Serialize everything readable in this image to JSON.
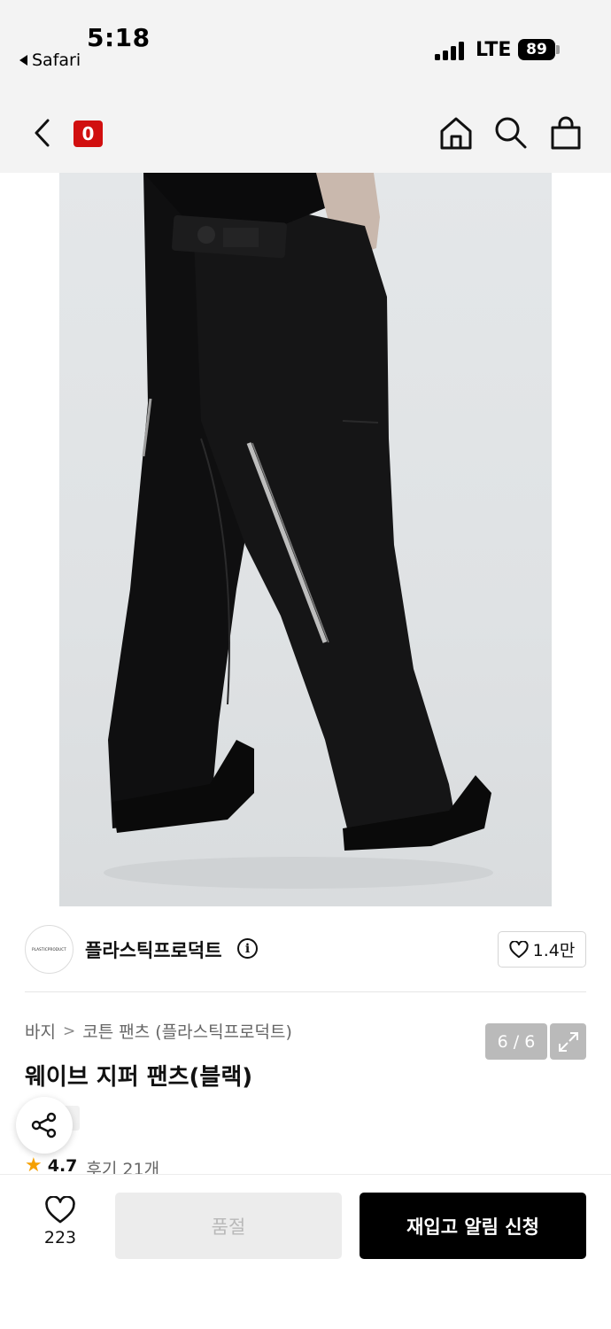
{
  "status_bar": {
    "time": "5:18",
    "back_app": "Safari",
    "network": "LTE",
    "battery": "89"
  },
  "nav": {
    "badge": "0",
    "icons": [
      "back-icon",
      "home-icon",
      "search-icon",
      "shopping-bag-icon"
    ]
  },
  "gallery": {
    "counter": "6 / 6",
    "current_image": 6,
    "total_images": 6
  },
  "brand": {
    "logo_text": "PLASTICPRODUCT",
    "name": "플라스틱프로덕트",
    "likes": "1.4만"
  },
  "product": {
    "breadcrumb": [
      "바지",
      "코튼 팬츠 (플라스틱프로덕트)"
    ],
    "title": "웨이브 지퍼 팬츠(블랙)",
    "rating": "4.7",
    "reviews": "후기 21개"
  },
  "bottom_bar": {
    "wish_count": "223",
    "soldout_label": "품절",
    "restock_label": "재입고 알림 신청"
  },
  "colors": {
    "badge_red": "#d10f0f",
    "star": "#f5a000",
    "primary_button": "#000000",
    "disabled_button": "#ececec"
  }
}
